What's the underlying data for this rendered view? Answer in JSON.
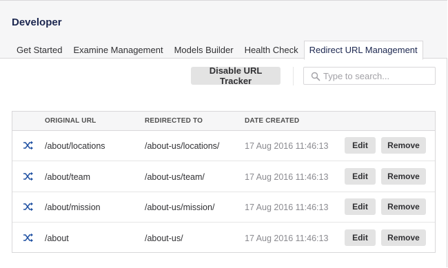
{
  "header": {
    "title": "Developer",
    "tabs": [
      {
        "label": "Get Started"
      },
      {
        "label": "Examine Management"
      },
      {
        "label": "Models Builder"
      },
      {
        "label": "Health Check"
      },
      {
        "label": "Redirect URL Management",
        "active": true
      }
    ]
  },
  "toolbar": {
    "disable_label": "Disable URL Tracker",
    "search_placeholder": "Type to search...",
    "search_value": ""
  },
  "table": {
    "columns": [
      "ORIGINAL URL",
      "REDIRECTED TO",
      "DATE CREATED"
    ],
    "rows": [
      {
        "original": "/about/locations",
        "redirected": "/about-us/locations/",
        "date": "17 Aug 2016 11:46:13",
        "edit": "Edit",
        "remove": "Remove"
      },
      {
        "original": "/about/team",
        "redirected": "/about-us/team/",
        "date": "17 Aug 2016 11:46:13",
        "edit": "Edit",
        "remove": "Remove"
      },
      {
        "original": "/about/mission",
        "redirected": "/about-us/mission/",
        "date": "17 Aug 2016 11:46:13",
        "edit": "Edit",
        "remove": "Remove"
      },
      {
        "original": "/about",
        "redirected": "/about-us/",
        "date": "17 Aug 2016 11:46:13",
        "edit": "Edit",
        "remove": "Remove"
      }
    ]
  },
  "icons": {
    "row_icon": "shuffle-icon",
    "search_icon": "search-icon"
  },
  "colors": {
    "accent_blue": "#2152a3",
    "button_bg": "#e3e3e3",
    "header_bg": "#f6f6f7"
  }
}
